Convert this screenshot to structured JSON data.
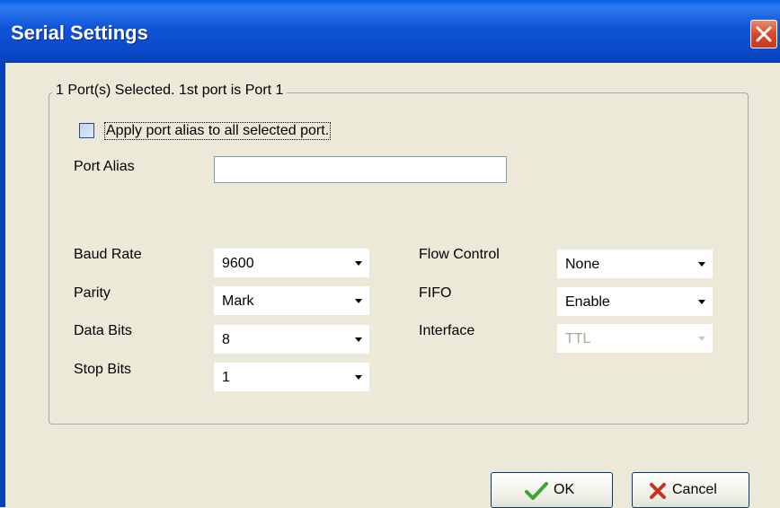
{
  "window": {
    "title": "Serial Settings",
    "close_icon": "close-icon"
  },
  "group": {
    "legend": "1 Port(s) Selected. 1st port is Port 1",
    "apply_alias_label": "Apply port alias to all selected port.",
    "apply_alias_checked": false,
    "port_alias_label": "Port Alias",
    "port_alias_value": ""
  },
  "left_fields": [
    {
      "label": "Baud Rate",
      "value": "9600"
    },
    {
      "label": "Parity",
      "value": "Mark"
    },
    {
      "label": "Data Bits",
      "value": "8"
    },
    {
      "label": "Stop Bits",
      "value": "1"
    }
  ],
  "right_fields": [
    {
      "label": "Flow Control",
      "value": "None",
      "enabled": true
    },
    {
      "label": "FIFO",
      "value": "Enable",
      "enabled": true
    },
    {
      "label": "Interface",
      "value": "TTL",
      "enabled": false
    }
  ],
  "buttons": {
    "ok": "OK",
    "cancel": "Cancel"
  },
  "colors": {
    "title_bar": "#0a48c8",
    "close": "#d9482a",
    "ok_check": "#3aa62e",
    "cancel_x": "#c8321e"
  }
}
